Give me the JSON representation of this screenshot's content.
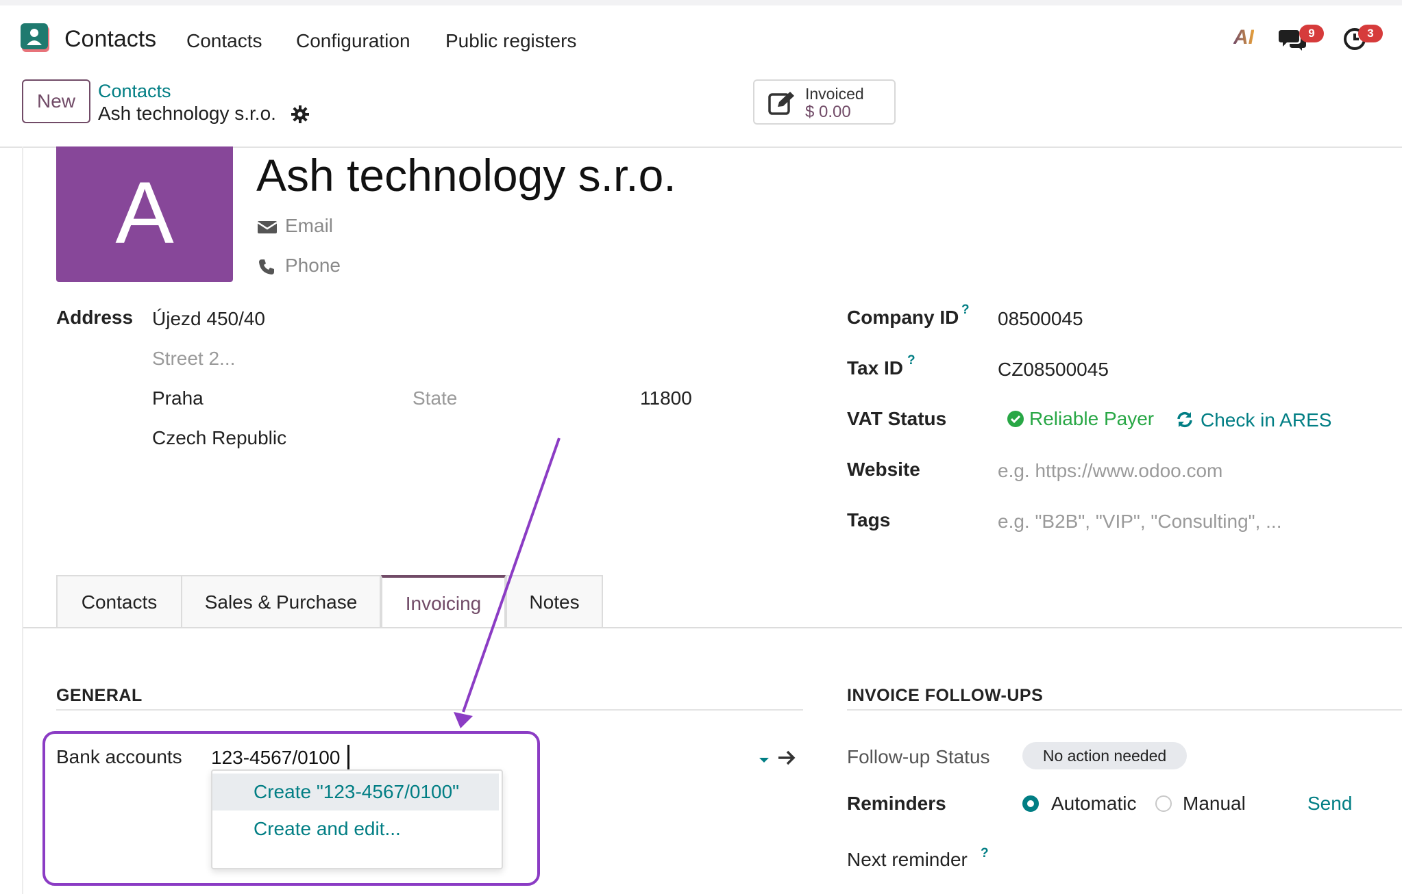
{
  "topbar": {
    "app_name": "Contacts",
    "menu": [
      "Contacts",
      "Configuration",
      "Public registers"
    ],
    "ai_label": "AI",
    "messages_count": "9",
    "activities_count": "3"
  },
  "control": {
    "new_label": "New",
    "breadcrumb_parent": "Contacts",
    "breadcrumb_current": "Ash technology s.r.o.",
    "stat_label": "Invoiced",
    "stat_value": "$ 0.00"
  },
  "partner": {
    "avatar_letter": "A",
    "avatar_color": "#874799",
    "name": "Ash technology s.r.o.",
    "email_placeholder": "Email",
    "phone_placeholder": "Phone"
  },
  "address": {
    "label": "Address",
    "street": "Újezd 450/40",
    "street2_placeholder": "Street 2...",
    "city": "Praha",
    "state_placeholder": "State",
    "zip": "11800",
    "country": "Czech Republic"
  },
  "right_fields": {
    "company_id_label": "Company ID",
    "company_id": "08500045",
    "tax_id_label": "Tax ID",
    "tax_id": "CZ08500045",
    "vat_status_label": "VAT Status",
    "vat_status": "Reliable Payer",
    "check_ares": "Check in ARES",
    "website_label": "Website",
    "website_placeholder": "e.g. https://www.odoo.com",
    "tags_label": "Tags",
    "tags_placeholder": "e.g. \"B2B\", \"VIP\", \"Consulting\", ..."
  },
  "help_mark": "?",
  "tabs": [
    "Contacts",
    "Sales & Purchase",
    "Invoicing",
    "Notes"
  ],
  "active_tab": "Invoicing",
  "general": {
    "title": "GENERAL",
    "bank_label": "Bank accounts",
    "bank_value": "123-4567/0100",
    "dropdown": [
      "Create \"123-4567/0100\"",
      "Create and edit..."
    ]
  },
  "followups": {
    "title": "INVOICE FOLLOW-UPS",
    "status_label": "Follow-up Status",
    "status_value": "No action needed",
    "reminders_label": "Reminders",
    "reminder_options": [
      "Automatic",
      "Manual"
    ],
    "reminder_selected": "Automatic",
    "send_label": "Send",
    "next_reminder_label": "Next reminder"
  },
  "colors": {
    "brand": "#714b67",
    "link": "#017e84",
    "annotation": "#8b3cc4",
    "success": "#28a745"
  }
}
